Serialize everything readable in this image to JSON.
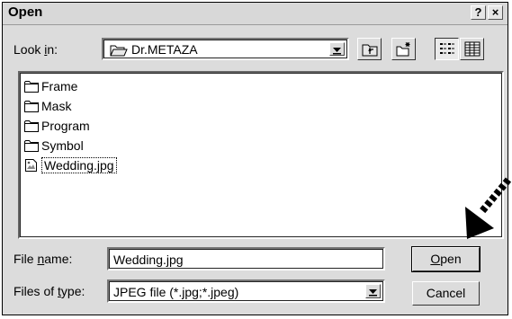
{
  "window": {
    "title": "Open",
    "help_glyph": "?",
    "close_glyph": "×"
  },
  "look_in": {
    "label_pre": "Look ",
    "label_key": "i",
    "label_post": "n:",
    "value": "Dr.METAZA"
  },
  "toolbar_icons": [
    "up-one-level-icon",
    "create-new-folder-icon",
    "list-view-icon",
    "details-view-icon"
  ],
  "files": [
    {
      "name": "Frame",
      "icon": "folder-icon"
    },
    {
      "name": "Mask",
      "icon": "folder-icon"
    },
    {
      "name": "Program",
      "icon": "folder-icon"
    },
    {
      "name": "Symbol",
      "icon": "folder-icon"
    },
    {
      "name": "Wedding.jpg",
      "icon": "image-file-icon",
      "selected": true
    }
  ],
  "file_name": {
    "label_pre": "File ",
    "label_key": "n",
    "label_post": "ame:",
    "value": "Wedding.jpg"
  },
  "file_type": {
    "label_pre": "Files of ",
    "label_key": "t",
    "label_post": "ype:",
    "value": "JPEG file (*.jpg;*.jpeg)"
  },
  "buttons": {
    "open_key": "O",
    "open_rest": "pen",
    "cancel": "Cancel"
  },
  "colors": {
    "dialog_bg": "#dcdcdc",
    "field_bg": "#ffffff",
    "text": "#000000"
  }
}
